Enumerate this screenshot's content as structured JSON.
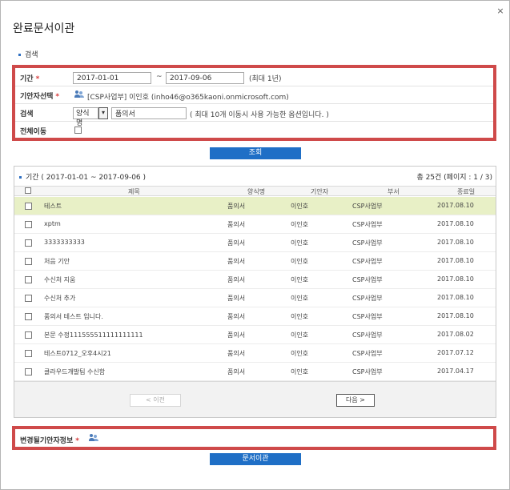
{
  "dialog": {
    "title": "완료문서이관",
    "close_glyph": "×"
  },
  "search_section": {
    "label": "검색",
    "period": {
      "label": "기간",
      "start": "2017-01-01",
      "tilde": "~",
      "end": "2017-09-06",
      "note": "(최대 1년)"
    },
    "drafter": {
      "label": "기안자선택",
      "value": "[CSP사업부] 이인호 (inho46@o365kaoni.onmicrosoft.com)"
    },
    "search": {
      "label": "검색",
      "select_value": "양식명",
      "select_arrow": "▾",
      "text": "품의서",
      "note": "( 최대 10개 이동시 사용 가능한 옵션입니다. )"
    },
    "move_all": {
      "label": "전체이동"
    },
    "button": "조회"
  },
  "list": {
    "title": "기간 ( 2017-01-01 ~ 2017-09-06 )",
    "count": "총 25건  (페이지 : 1 / 3)",
    "columns": [
      "제목",
      "양식명",
      "기안자",
      "부서",
      "종료일"
    ],
    "rows": [
      {
        "title": "테스트",
        "form": "품의서",
        "drafter": "이인호",
        "dept": "CSP사업부",
        "date": "2017.08.10"
      },
      {
        "title": "xptm",
        "form": "품의서",
        "drafter": "이인호",
        "dept": "CSP사업부",
        "date": "2017.08.10"
      },
      {
        "title": "3333333333",
        "form": "품의서",
        "drafter": "이인호",
        "dept": "CSP사업부",
        "date": "2017.08.10"
      },
      {
        "title": "처음 기안",
        "form": "품의서",
        "drafter": "이인호",
        "dept": "CSP사업부",
        "date": "2017.08.10"
      },
      {
        "title": "수신처 지움",
        "form": "품의서",
        "drafter": "이인호",
        "dept": "CSP사업부",
        "date": "2017.08.10"
      },
      {
        "title": "수신처 추가",
        "form": "품의서",
        "drafter": "이인호",
        "dept": "CSP사업부",
        "date": "2017.08.10"
      },
      {
        "title": "품의서 테스트 입니다.",
        "form": "품의서",
        "drafter": "이인호",
        "dept": "CSP사업부",
        "date": "2017.08.10"
      },
      {
        "title": "본문 수정111555511111111111",
        "form": "품의서",
        "drafter": "이인호",
        "dept": "CSP사업부",
        "date": "2017.08.02"
      },
      {
        "title": "테스트0712_오후4시21",
        "form": "품의서",
        "drafter": "이인호",
        "dept": "CSP사업부",
        "date": "2017.07.12"
      },
      {
        "title": "클라우드개발팀 수신함",
        "form": "품의서",
        "drafter": "이인호",
        "dept": "CSP사업부",
        "date": "2017.04.17"
      }
    ],
    "prev": "< 이전",
    "next": "다음 >"
  },
  "changed_drafter": {
    "label": "변경될기안자정보"
  },
  "move_button": "문서이관",
  "colors": {
    "accent": "#1f6fc6",
    "highlight_box": "#cf4a4a",
    "selected_row": "#e8f0c6"
  },
  "icons": [
    "close-icon",
    "person-select-icon",
    "chevron-down-icon"
  ]
}
